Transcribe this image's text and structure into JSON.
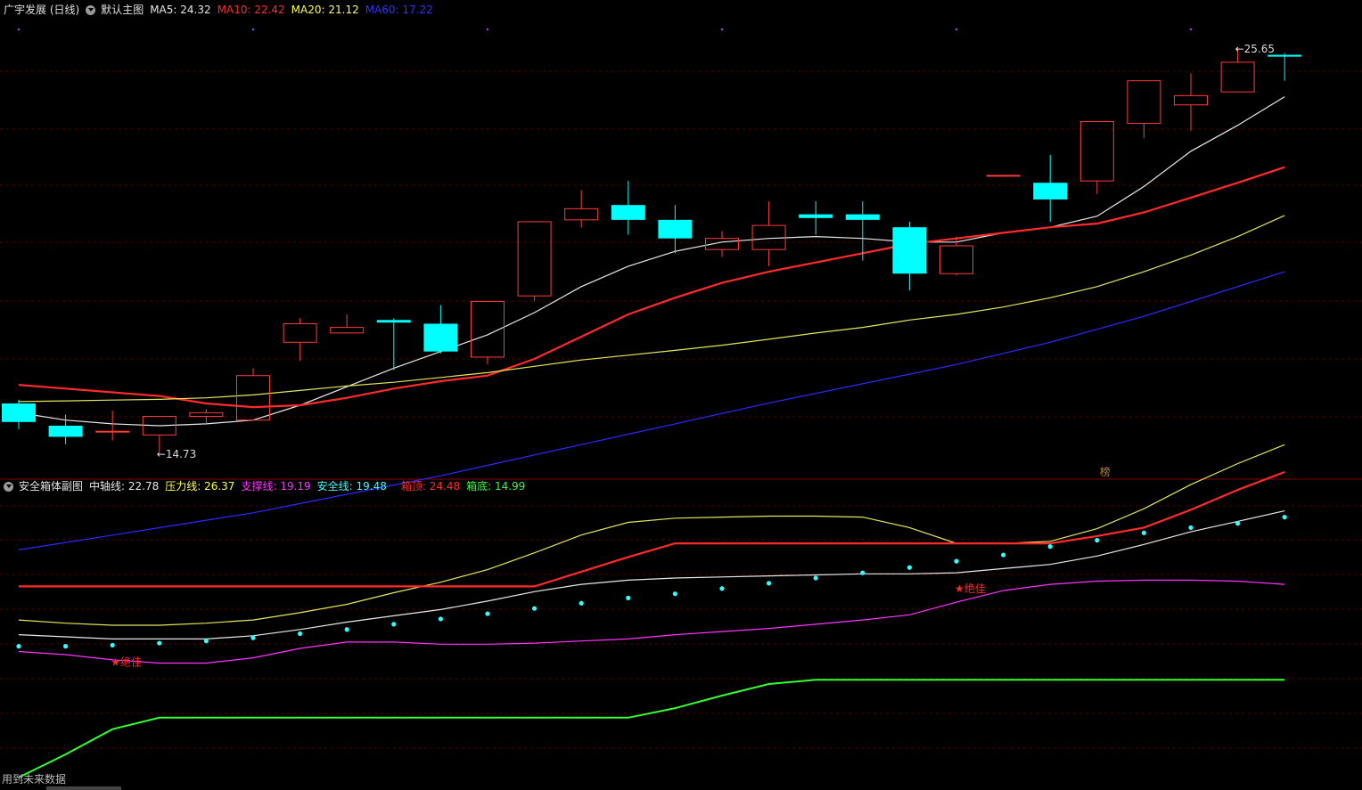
{
  "main_header": {
    "stock": "广宇发展 (日线)",
    "chart": "默认主图",
    "ma5": {
      "label": "MA5: 24.32",
      "color": "#e6e6e6"
    },
    "ma10": {
      "label": "MA10: 22.42",
      "color": "#ff2b2b"
    },
    "ma20": {
      "label": "MA20: 21.12",
      "color": "#ffff55"
    },
    "ma60": {
      "label": "MA60: 17.22",
      "color": "#3030ff"
    }
  },
  "sub_header": {
    "name": "安全箱体副图",
    "axis": {
      "label": "中轴线: 22.78",
      "color": "#e6e6e6"
    },
    "pressure": {
      "label": "压力线: 26.37",
      "color": "#ffff55"
    },
    "support": {
      "label": "支撑线: 19.19",
      "color": "#ff33ff"
    },
    "safety": {
      "label": "安全线: 19.48",
      "color": "#33ffff"
    },
    "box_top": {
      "label": "箱顶: 24.48",
      "color": "#ff2b2b"
    },
    "box_bottom": {
      "label": "箱底: 14.99",
      "color": "#33ff33"
    }
  },
  "footer": {
    "text": "用到未来数据"
  },
  "colors": {
    "up": "#ff3b3b",
    "down": "#00ffff",
    "grid": "#5a0000",
    "divider": "#8a0000",
    "badge": "#b08040"
  },
  "chart_data": [
    {
      "type": "candlestick",
      "title": "广宇发展 (日线)",
      "ylim": [
        14.2,
        26.4
      ],
      "annotations": [
        {
          "label": "←14.73",
          "index": 3,
          "value": 14.73
        },
        {
          "label": "←25.65",
          "index": 26,
          "value": 25.65
        },
        {
          "label": "榜",
          "index": 23
        }
      ],
      "candles": [
        {
          "o": 16.05,
          "c": 15.55,
          "h": 16.15,
          "l": 15.35
        },
        {
          "o": 15.45,
          "c": 15.15,
          "h": 15.75,
          "l": 14.95
        },
        {
          "o": 15.3,
          "c": 15.3,
          "h": 15.85,
          "l": 15.05
        },
        {
          "o": 15.2,
          "c": 15.7,
          "h": 15.7,
          "l": 14.75
        },
        {
          "o": 15.7,
          "c": 15.8,
          "h": 15.9,
          "l": 15.5
        },
        {
          "o": 15.6,
          "c": 16.8,
          "h": 17.0,
          "l": 15.6
        },
        {
          "o": 17.7,
          "c": 18.2,
          "h": 18.35,
          "l": 17.2
        },
        {
          "o": 17.95,
          "c": 18.1,
          "h": 18.45,
          "l": 17.95
        },
        {
          "o": 18.3,
          "c": 18.23,
          "h": 18.35,
          "l": 16.95
        },
        {
          "o": 18.2,
          "c": 17.45,
          "h": 18.7,
          "l": 17.4
        },
        {
          "o": 17.3,
          "c": 18.8,
          "h": 18.8,
          "l": 17.1
        },
        {
          "o": 18.95,
          "c": 20.95,
          "h": 20.95,
          "l": 18.8
        },
        {
          "o": 21.0,
          "c": 21.3,
          "h": 21.8,
          "l": 20.8
        },
        {
          "o": 21.4,
          "c": 21.0,
          "h": 22.05,
          "l": 20.6
        },
        {
          "o": 21.0,
          "c": 20.5,
          "h": 21.4,
          "l": 20.1
        },
        {
          "o": 20.2,
          "c": 20.5,
          "h": 20.7,
          "l": 20.0
        },
        {
          "o": 20.2,
          "c": 20.85,
          "h": 21.5,
          "l": 19.75
        },
        {
          "o": 21.15,
          "c": 21.05,
          "h": 21.5,
          "l": 20.6
        },
        {
          "o": 21.15,
          "c": 21.0,
          "h": 21.5,
          "l": 19.9
        },
        {
          "o": 20.8,
          "c": 19.55,
          "h": 20.95,
          "l": 19.1
        },
        {
          "o": 19.55,
          "c": 20.3,
          "h": 20.55,
          "l": 19.5
        },
        {
          "o": 22.2,
          "c": 22.2,
          "h": 22.2,
          "l": 22.2
        },
        {
          "o": 22.0,
          "c": 21.55,
          "h": 22.75,
          "l": 20.95
        },
        {
          "o": 22.05,
          "c": 23.65,
          "h": 23.65,
          "l": 21.7
        },
        {
          "o": 23.6,
          "c": 24.75,
          "h": 24.75,
          "l": 23.2
        },
        {
          "o": 24.1,
          "c": 24.35,
          "h": 24.95,
          "l": 23.4
        },
        {
          "o": 24.45,
          "c": 25.25,
          "h": 25.65,
          "l": 24.45
        },
        {
          "o": 25.45,
          "c": 25.4,
          "h": 25.5,
          "l": 24.75
        }
      ],
      "series": [
        {
          "name": "MA5",
          "values": [
            15.8,
            15.6,
            15.5,
            15.45,
            15.5,
            15.6,
            16.0,
            16.5,
            17.0,
            17.45,
            17.9,
            18.5,
            19.2,
            19.75,
            20.15,
            20.4,
            20.5,
            20.55,
            20.5,
            20.4,
            20.4,
            20.65,
            20.8,
            21.1,
            21.9,
            22.85,
            23.55,
            24.32
          ]
        },
        {
          "name": "MA10",
          "values": [
            16.55,
            16.45,
            16.35,
            16.25,
            16.05,
            15.95,
            16.0,
            16.2,
            16.45,
            16.65,
            16.8,
            17.25,
            17.85,
            18.45,
            18.9,
            19.3,
            19.6,
            19.85,
            20.1,
            20.35,
            20.5,
            20.65,
            20.8,
            20.9,
            21.2,
            21.6,
            22.0,
            22.42
          ]
        },
        {
          "name": "MA20",
          "values": [
            16.1,
            16.12,
            16.14,
            16.16,
            16.2,
            16.28,
            16.4,
            16.52,
            16.62,
            16.75,
            16.88,
            17.05,
            17.22,
            17.35,
            17.48,
            17.62,
            17.78,
            17.95,
            18.1,
            18.3,
            18.45,
            18.65,
            18.9,
            19.2,
            19.6,
            20.05,
            20.55,
            21.12
          ]
        },
        {
          "name": "MA60",
          "values": [
            12.1,
            12.3,
            12.5,
            12.7,
            12.9,
            13.1,
            13.35,
            13.6,
            13.85,
            14.1,
            14.38,
            14.66,
            14.94,
            15.22,
            15.5,
            15.78,
            16.06,
            16.32,
            16.58,
            16.84,
            17.1,
            17.4,
            17.7,
            18.05,
            18.4,
            18.8,
            19.2,
            19.6
          ]
        }
      ]
    },
    {
      "type": "line",
      "title": "安全箱体副图",
      "ylim": [
        13.6,
        27.6
      ],
      "annotations": [
        {
          "label": "★绝佳",
          "index": 2,
          "value": 19.4
        },
        {
          "label": "★绝佳",
          "index": 20,
          "value": 22.9
        }
      ],
      "series": [
        {
          "name": "中轴线",
          "values": [
            20.7,
            20.6,
            20.5,
            20.5,
            20.5,
            20.65,
            20.95,
            21.3,
            21.6,
            21.9,
            22.3,
            22.75,
            23.1,
            23.3,
            23.4,
            23.45,
            23.5,
            23.55,
            23.6,
            23.6,
            23.65,
            23.85,
            24.05,
            24.45,
            25.0,
            25.6,
            26.1,
            26.6
          ]
        },
        {
          "name": "压力线",
          "values": [
            21.4,
            21.25,
            21.15,
            21.15,
            21.25,
            21.4,
            21.75,
            22.15,
            22.7,
            23.2,
            23.8,
            24.6,
            25.45,
            26.05,
            26.25,
            26.3,
            26.35,
            26.35,
            26.3,
            25.8,
            25.05,
            25.05,
            25.15,
            25.75,
            26.7,
            27.85,
            28.85,
            29.75
          ]
        },
        {
          "name": "支撑线",
          "values": [
            19.9,
            19.75,
            19.5,
            19.35,
            19.35,
            19.6,
            20.05,
            20.35,
            20.35,
            20.25,
            20.25,
            20.3,
            20.4,
            20.5,
            20.7,
            20.85,
            21.0,
            21.2,
            21.4,
            21.65,
            22.25,
            22.8,
            23.1,
            23.25,
            23.3,
            23.3,
            23.25,
            23.1
          ]
        },
        {
          "name": "安全线",
          "values": [
            20.15,
            20.15,
            20.2,
            20.3,
            20.4,
            20.55,
            20.75,
            20.95,
            21.2,
            21.45,
            21.7,
            21.95,
            22.2,
            22.45,
            22.65,
            22.9,
            23.15,
            23.4,
            23.65,
            23.9,
            24.2,
            24.5,
            24.9,
            25.2,
            25.55,
            25.8,
            26.0,
            26.3
          ]
        },
        {
          "name": "箱顶",
          "values": [
            23.0,
            23.0,
            23.0,
            23.0,
            23.0,
            23.0,
            23.0,
            23.0,
            23.0,
            23.0,
            23.0,
            23.0,
            23.7,
            24.4,
            25.05,
            25.05,
            25.05,
            25.05,
            25.05,
            25.05,
            25.05,
            25.05,
            25.05,
            25.4,
            25.8,
            26.65,
            27.6,
            28.45
          ]
        },
        {
          "name": "箱底",
          "values": [
            13.9,
            15.0,
            16.2,
            16.75,
            16.75,
            16.75,
            16.75,
            16.75,
            16.75,
            16.75,
            16.75,
            16.75,
            16.75,
            16.75,
            17.2,
            17.8,
            18.35,
            18.55,
            18.55,
            18.55,
            18.55,
            18.55,
            18.55,
            18.55,
            18.55,
            18.55,
            18.55,
            18.55
          ]
        }
      ]
    }
  ]
}
